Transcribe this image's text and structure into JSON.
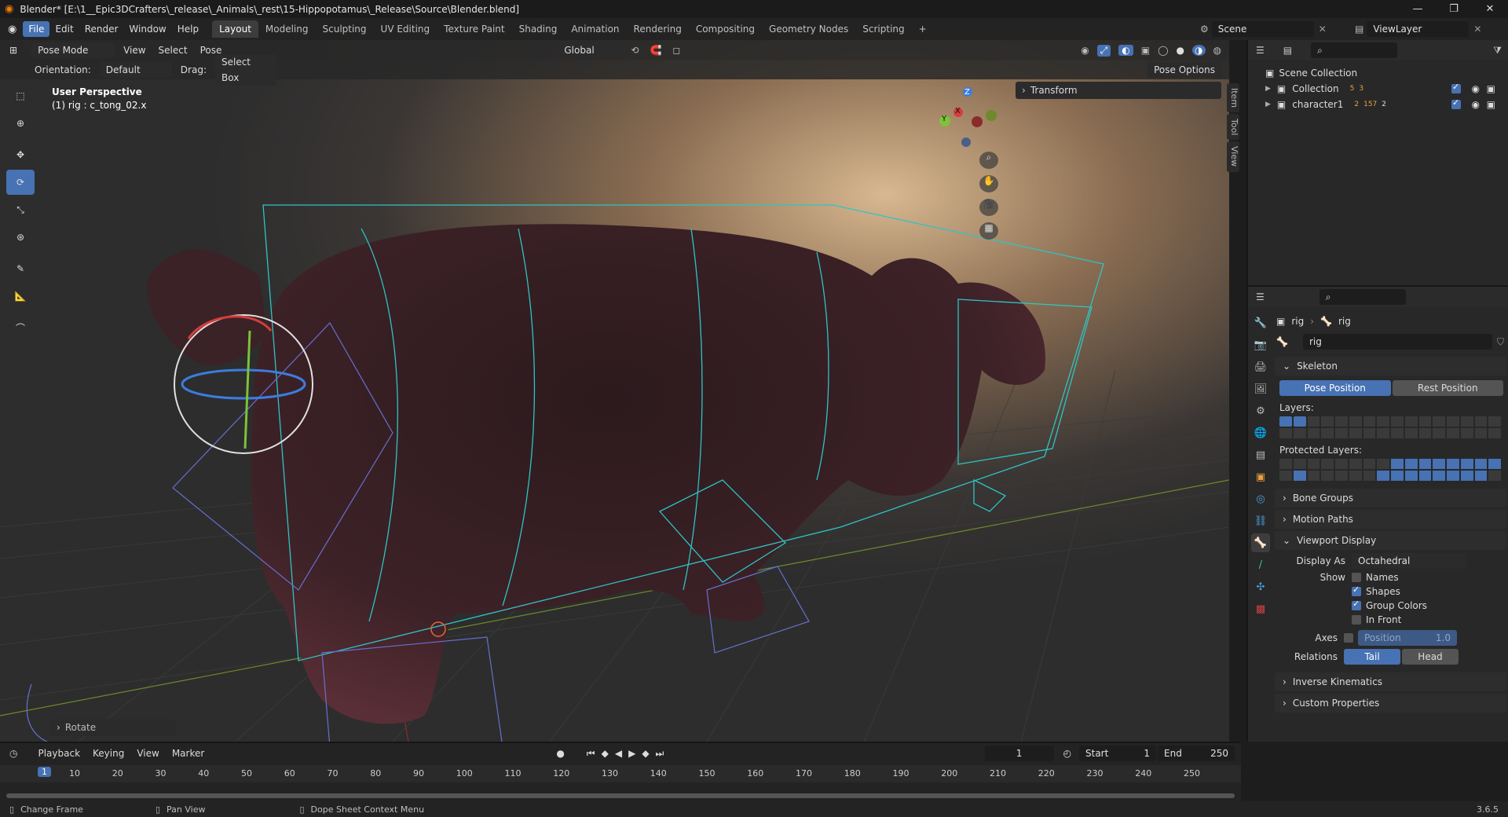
{
  "window": {
    "title": "Blender* [E:\\1__Epic3DCrafters\\_release\\_Animals\\_rest\\15-Hippopotamus\\_Release\\Source\\Blender.blend]",
    "min": "—",
    "max": "❐",
    "close": "✕"
  },
  "menu": [
    "File",
    "Edit",
    "Render",
    "Window",
    "Help"
  ],
  "workspaces": [
    "Layout",
    "Modeling",
    "Sculpting",
    "UV Editing",
    "Texture Paint",
    "Shading",
    "Animation",
    "Rendering",
    "Compositing",
    "Geometry Nodes",
    "Scripting"
  ],
  "active_workspace": "Layout",
  "scene": {
    "name": "Scene",
    "view_layer": "ViewLayer"
  },
  "viewport_header": {
    "mode": "Pose Mode",
    "menus": [
      "View",
      "Select",
      "Pose"
    ],
    "transform": "Global",
    "pose_options": "Pose Options"
  },
  "viewport_header2": {
    "orientation_label": "Orientation:",
    "orientation_value": "Default",
    "drag_label": "Drag:",
    "drag_value": "Select Box"
  },
  "viewport": {
    "perspective": "User Perspective",
    "object_info": "(1) rig : c_tong_02.x",
    "transform_panel": "Transform",
    "last_op": "Rotate",
    "side_tabs": [
      "Item",
      "Tool",
      "View"
    ],
    "gizmo_axes": [
      "Z",
      "Y",
      "X"
    ]
  },
  "outliner": {
    "root": "Scene Collection",
    "items": [
      {
        "name": "Collection",
        "badges": [
          "5",
          "3"
        ]
      },
      {
        "name": "character1",
        "badges": [
          "2",
          "157",
          "2"
        ]
      }
    ],
    "search_placeholder": ""
  },
  "properties": {
    "breadcrumb": [
      "rig",
      "rig"
    ],
    "data_name": "rig",
    "skeleton_title": "Skeleton",
    "pose_position": "Pose Position",
    "rest_position": "Rest Position",
    "layers_label": "Layers:",
    "protected_label": "Protected Layers:",
    "collapsed_sections": [
      "Bone Groups",
      "Motion Paths"
    ],
    "viewport_display_title": "Viewport Display",
    "display_as_label": "Display As",
    "display_as_value": "Octahedral",
    "show_label": "Show",
    "show_items": [
      {
        "label": "Names",
        "checked": false
      },
      {
        "label": "Shapes",
        "checked": true
      },
      {
        "label": "Group Colors",
        "checked": true
      },
      {
        "label": "In Front",
        "checked": false
      }
    ],
    "axes_label": "Axes",
    "axes_position_label": "Position",
    "axes_position_value": "1.0",
    "relations_label": "Relations",
    "relations_tail": "Tail",
    "relations_head": "Head",
    "bottom_sections": [
      "Inverse Kinematics",
      "Custom Properties"
    ]
  },
  "timeline": {
    "menus": [
      "Playback",
      "Keying",
      "View",
      "Marker"
    ],
    "current_frame": "1",
    "start_label": "Start",
    "start": "1",
    "end_label": "End",
    "end": "250",
    "ruler": [
      "10",
      "20",
      "30",
      "40",
      "50",
      "60",
      "70",
      "80",
      "90",
      "100",
      "110",
      "120",
      "130",
      "140",
      "150",
      "160",
      "170",
      "180",
      "190",
      "200",
      "210",
      "220",
      "230",
      "240",
      "250"
    ]
  },
  "statusbar": {
    "left": "Change Frame",
    "mid": "Pan View",
    "right": "Dope Sheet Context Menu",
    "version": "3.6.5"
  },
  "colors": {
    "accent": "#4772b3",
    "rig_lines": "#2ec4c4",
    "hippo": "#3a1f24",
    "grid_x": "#8a2c2c",
    "grid_y": "#6d8a2c"
  }
}
